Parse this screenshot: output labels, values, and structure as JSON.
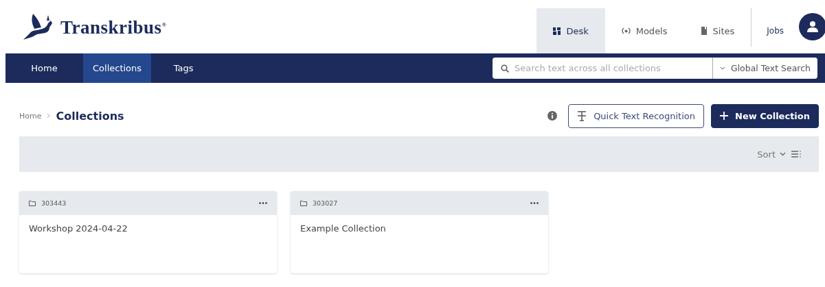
{
  "logo": {
    "text": "Transkribus$^{®}$"
  },
  "top_nav": [
    {
      "label": "Desk",
      "kind": "desk",
      "selected": true
    },
    {
      "label": "Models",
      "kind": "models",
      "selected": false
    },
    {
      "label": "Sites",
      "kind": "sites",
      "selected": false
    },
    {
      "label": "Jobs",
      "kind": "jobs",
      "selected": false
    }
  ],
  "main_nav": [
    {
      "label": "Home",
      "selected": false
    },
    {
      "label": "Collections",
      "selected": true
    },
    {
      "label": "Tags",
      "selected": false
    }
  ],
  "search": {
    "placeholder": "Search text across all collections",
    "mode": "Global Text Search"
  },
  "breadcrumb": {
    "parent": "Home",
    "current": "Collections"
  },
  "actions": [
    {
      "label": "Quick Text Recognition",
      "kind": "outline"
    },
    {
      "label": "New Collection",
      "kind": "primary"
    }
  ],
  "toolbar": {
    "sort": "Sort"
  },
  "collections": [
    {
      "id": "303443",
      "title": "Workshop 2024-04-22"
    },
    {
      "id": "303027",
      "title": "Example Collection"
    }
  ]
}
